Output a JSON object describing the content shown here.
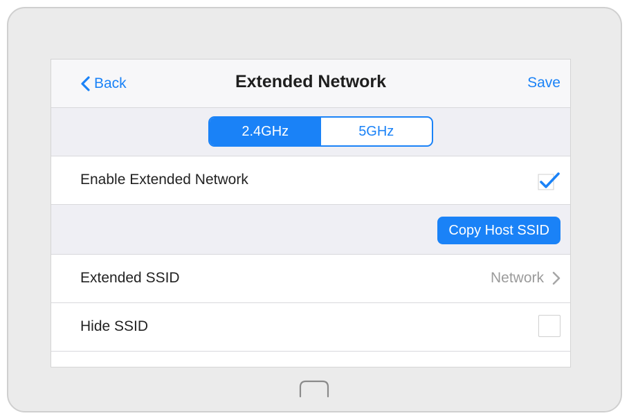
{
  "navbar": {
    "back_label": "Back",
    "title": "Extended Network",
    "save_label": "Save"
  },
  "band_selector": {
    "options": [
      "2.4GHz",
      "5GHz"
    ],
    "selected": "2.4GHz"
  },
  "settings": {
    "enable_extended_network": {
      "label": "Enable Extended Network",
      "checked": true
    },
    "copy_host_ssid_label": "Copy Host SSID",
    "extended_ssid": {
      "label": "Extended SSID",
      "value": "Network"
    },
    "hide_ssid": {
      "label": "Hide SSID",
      "checked": false
    }
  },
  "icons": {
    "back": "chevron-left-icon",
    "checkmark": "checkmark-icon",
    "disclosure": "chevron-right-icon",
    "home": "home-button-icon"
  },
  "colors": {
    "accent": "#1a82f7",
    "grouped_background": "#efeff4",
    "device_frame": "#ebebeb",
    "secondary_text": "#9b9b9b"
  }
}
